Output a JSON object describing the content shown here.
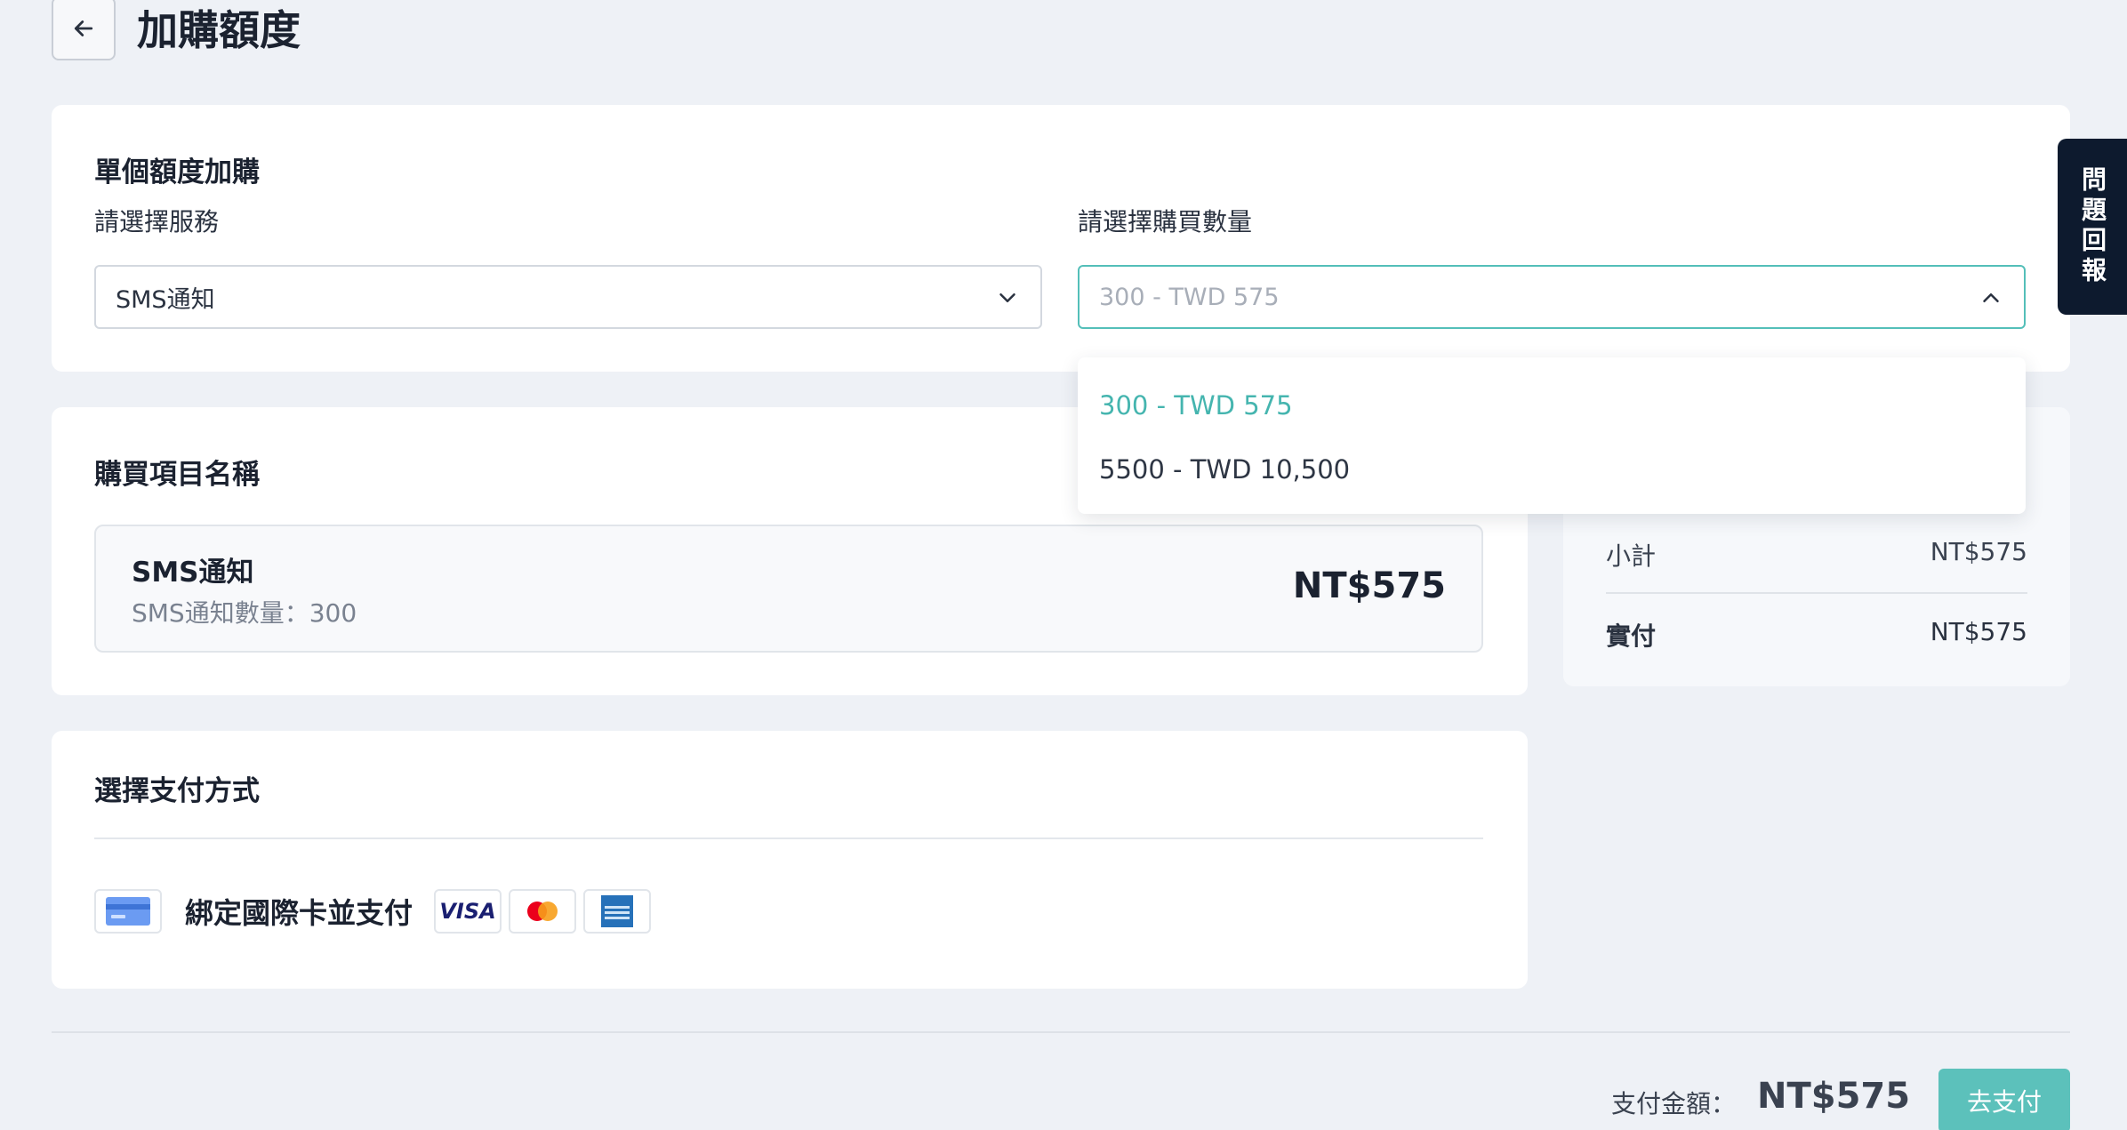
{
  "header": {
    "title": "加購額度"
  },
  "single_purchase": {
    "section_title": "單個額度加購",
    "service_label": "請選擇服務",
    "service_value": "SMS通知",
    "quantity_label": "請選擇購買數量",
    "quantity_placeholder": "300 - TWD 575",
    "quantity_options": [
      {
        "label": "300 - TWD 575",
        "selected": true
      },
      {
        "label": "5500 - TWD 10,500",
        "selected": false
      }
    ]
  },
  "items": {
    "section_title": "購買項目名稱",
    "item_name": "SMS通知",
    "item_desc": "SMS通知數量：300",
    "item_price": "NT$575"
  },
  "summary": {
    "subtotal_label": "小計",
    "subtotal_value": "NT$575",
    "total_label": "實付",
    "total_value": "NT$575"
  },
  "payment": {
    "section_title": "選擇支付方式",
    "method_label": "綁定國際卡並支付",
    "brands": [
      "visa-icon",
      "mastercard-icon",
      "amex-icon"
    ]
  },
  "feedback": {
    "label": "問題回報"
  },
  "footer": {
    "amount_label": "支付金額：",
    "amount_value": "NT$575",
    "pay_button": "去支付"
  },
  "colors": {
    "accent": "#5cc1bb",
    "accent_text": "#45b5af",
    "background": "#eef1f6",
    "feedback_bg": "#0d1a2e"
  }
}
